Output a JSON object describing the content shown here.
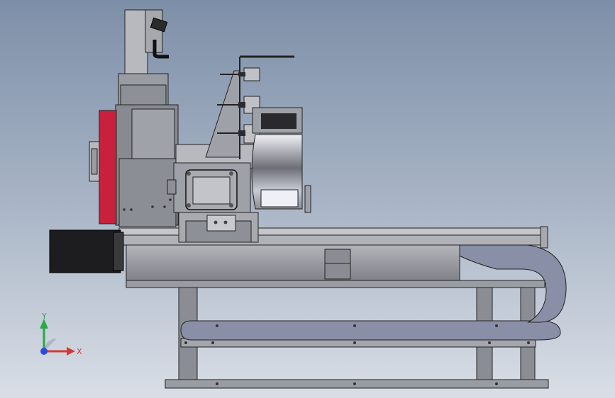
{
  "app": {
    "view": "Right view",
    "display_mode": "shaded-with-edges"
  },
  "triad": {
    "y_label": "Y",
    "x_label": "X",
    "y_color": "#2aa84a",
    "x_color": "#d23a3a",
    "z_color": "#2b4bd8"
  },
  "colors": {
    "background_top": "#7d8fa8",
    "background_bottom": "#d9dee6",
    "metal_dark": "#6f7279",
    "metal_mid": "#9a9ca3",
    "metal_light": "#c4c6cc",
    "spindle_red": "#c8213d",
    "motor_black": "#1d1d1f",
    "drag_chain": "#8a8fa8"
  }
}
